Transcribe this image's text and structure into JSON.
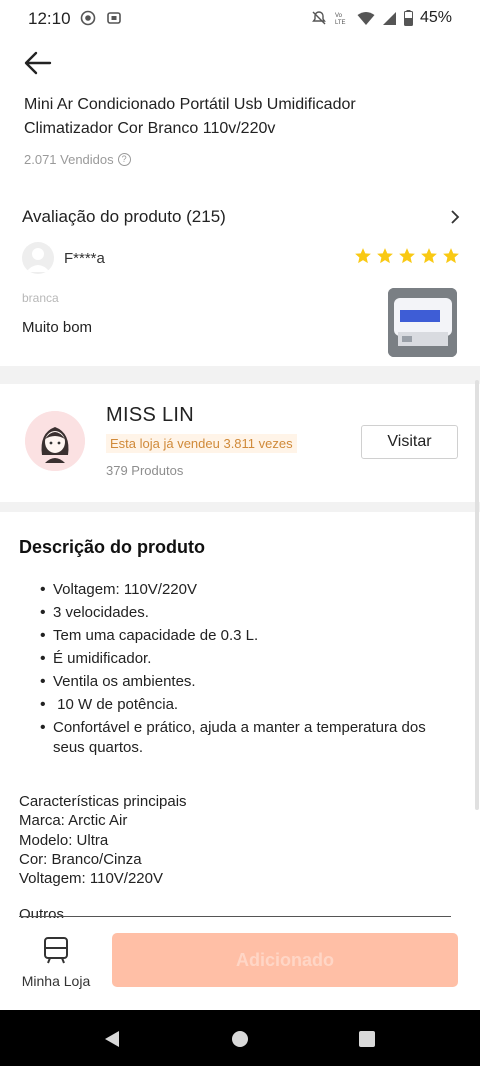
{
  "status_bar": {
    "time": "12:10",
    "battery": "45%",
    "icons": [
      "screen-record-icon",
      "cast-icon",
      "mute-icon",
      "volte-icon",
      "wifi-icon",
      "signal-icon",
      "battery-icon"
    ]
  },
  "product": {
    "title": "Mini Ar Condicionado Portátil Usb Umidificador Climatizador Cor Branco 110v/220v",
    "sold": "2.071 Vendidos"
  },
  "reviews": {
    "header": "Avaliação do produto (215)",
    "reviewer": "F****a",
    "rating": 5,
    "variant": "branca",
    "comment": "Muito bom"
  },
  "store": {
    "name": "MISS LIN",
    "badge": "Esta loja já vendeu 3.811 vezes",
    "products": "379 Produtos",
    "visit_label": "Visitar"
  },
  "description": {
    "title": "Descrição do produto",
    "bullets": [
      "Voltagem: 110V/220V",
      "3 velocidades.",
      "Tem uma capacidade de 0.3 L.",
      "É umidificador.",
      "Ventila os ambientes.",
      " 10 W de potência.",
      "Confortável e prático, ajuda a manter a temperatura dos seus quartos."
    ],
    "features": [
      "Características principais",
      "Marca: Arctic Air",
      "Modelo: Ultra",
      "Cor: Branco/Cinza",
      "Voltagem: 110V/220V"
    ],
    "outros": "Outros"
  },
  "bottom": {
    "mystore_label": "Minha Loja",
    "add_label": "Adicionado"
  },
  "colors": {
    "star": "#f9c914",
    "add_button": "#ffbfa6",
    "badge_text": "#d08a3a"
  }
}
